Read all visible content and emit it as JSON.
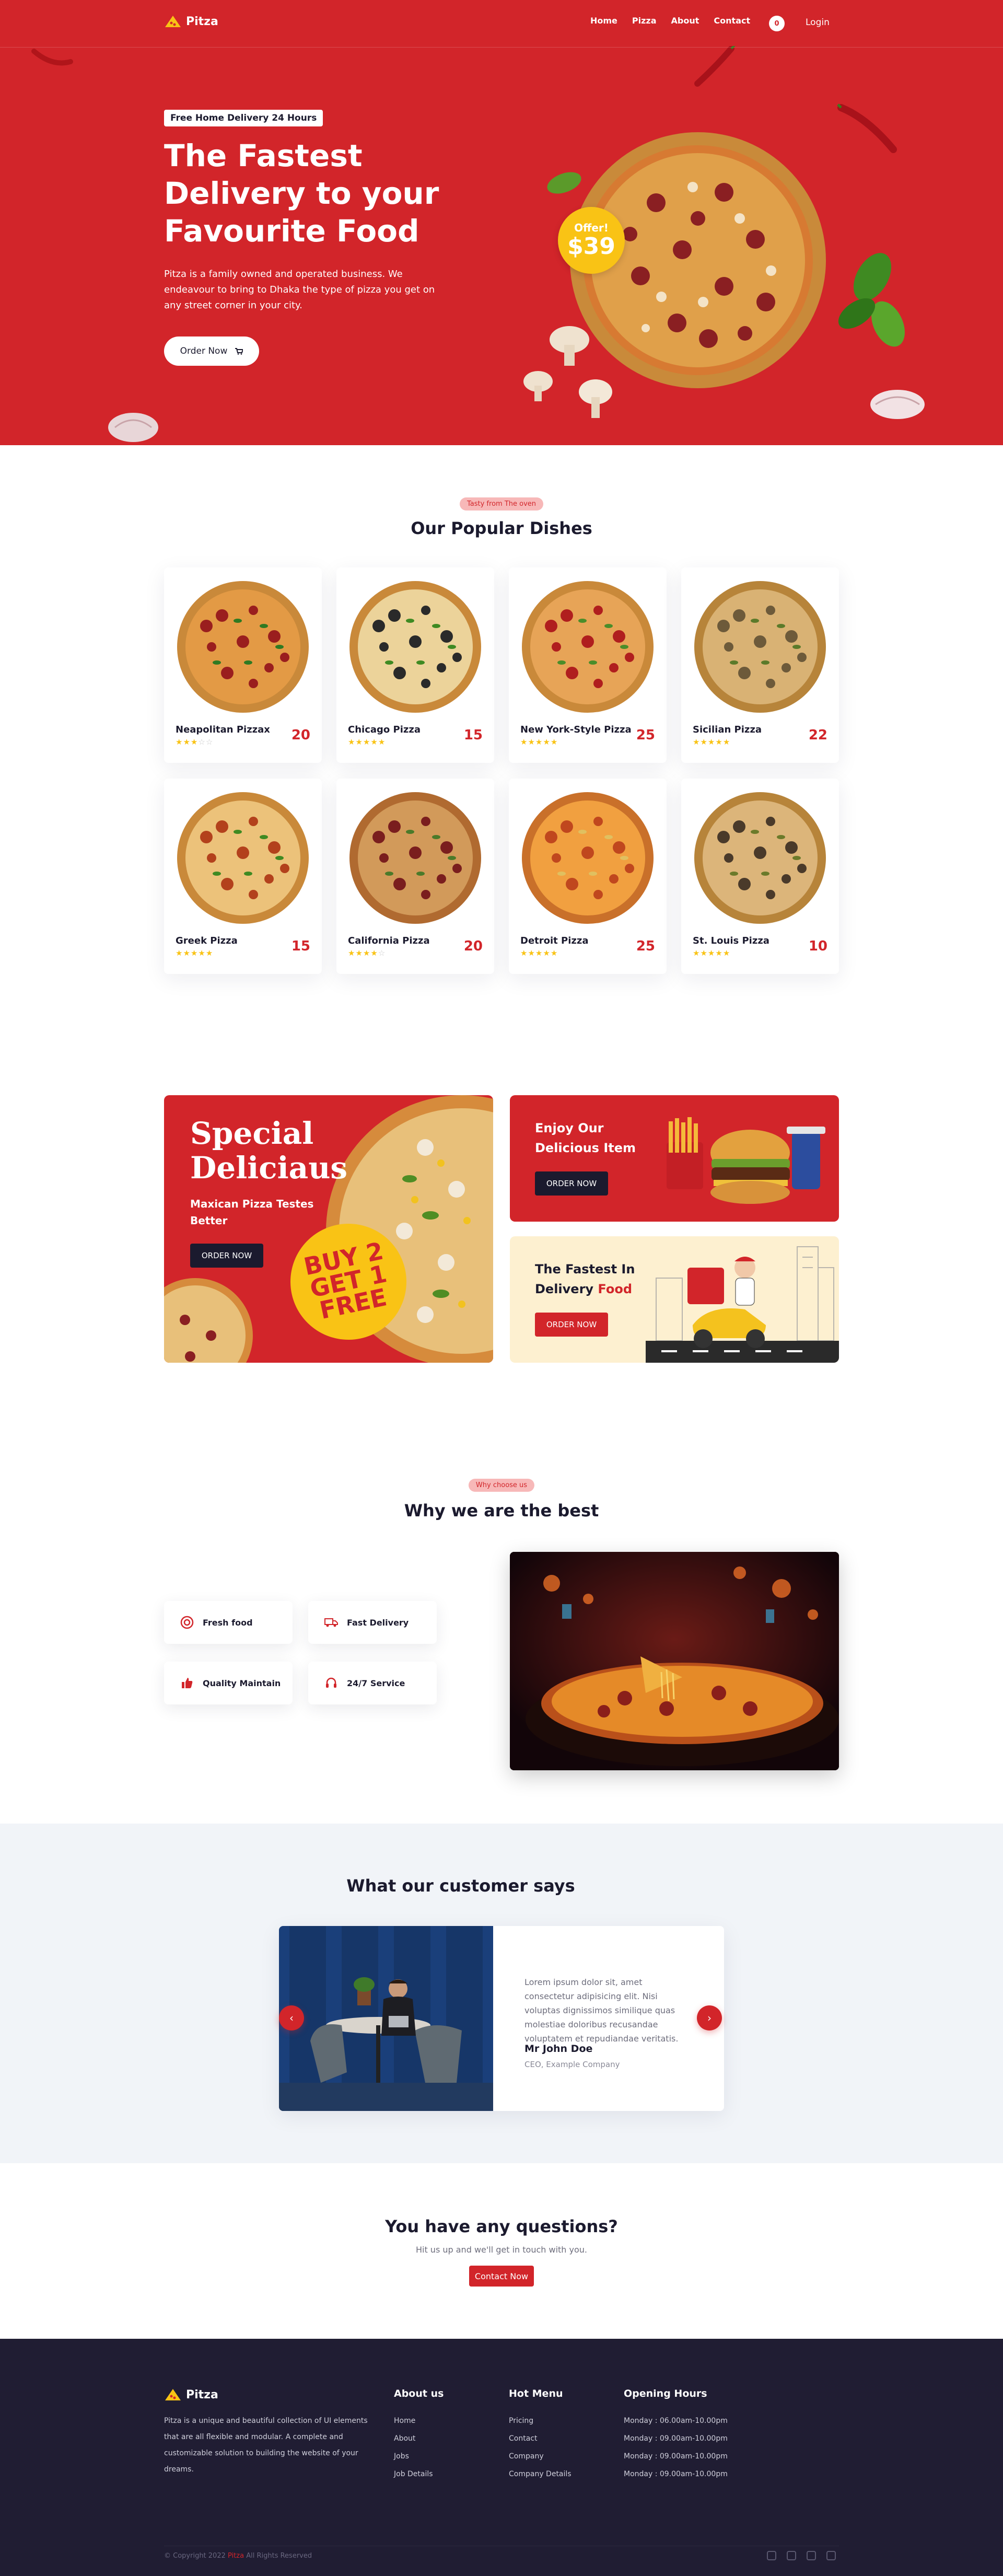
{
  "nav": {
    "brand": "Pitza",
    "links": [
      "Home",
      "Pizza",
      "About",
      "Contact"
    ],
    "cart_count": "0",
    "login": "Login"
  },
  "hero": {
    "badge": "Free Home Delivery 24 Hours",
    "title": "The Fastest Delivery to your Favourite Food",
    "description": "Pitza is a family owned and operated business. We endeavour to bring to Dhaka the type of pizza you get on any street corner in your city.",
    "cta": "Order Now",
    "offer_label": "Offer!",
    "offer_price": "$39"
  },
  "dishes": {
    "tag": "Tasty from The oven",
    "title": "Our Popular Dishes",
    "items": [
      {
        "name": "Neapolitan Pizzax",
        "price": "20",
        "rating": 3
      },
      {
        "name": "Chicago Pizza",
        "price": "15",
        "rating": 5
      },
      {
        "name": "New York-Style Pizza",
        "price": "25",
        "rating": 5
      },
      {
        "name": "Sicilian Pizza",
        "price": "22",
        "rating": 5
      },
      {
        "name": "Greek Pizza",
        "price": "15",
        "rating": 5
      },
      {
        "name": "California Pizza",
        "price": "20",
        "rating": 4
      },
      {
        "name": "Detroit Pizza",
        "price": "25",
        "rating": 5
      },
      {
        "name": "St. Louis Pizza",
        "price": "10",
        "rating": 5
      }
    ]
  },
  "promo": {
    "big_title": "Special Deliciaus",
    "big_subtitle": "Maxican Pizza Testes Better",
    "big_cta": "ORDER NOW",
    "buy_line1": "BUY 2",
    "buy_line2": "GET 1",
    "buy_line3": "FREE",
    "right1_title": "Enjoy Our Delicious Item",
    "right1_cta": "ORDER NOW",
    "right2_title_a": "The Fastest In Delivery ",
    "right2_title_b": "Food",
    "right2_cta": "ORDER NOW"
  },
  "why": {
    "tag": "Why choose us",
    "title": "Why we are the best",
    "features": [
      "Fresh food",
      "Fast Delivery",
      "Quality Maintain",
      "24/7 Service"
    ]
  },
  "testimonial": {
    "title": "What our customer says",
    "quote": "Lorem ipsum dolor sit, amet consectetur adipisicing elit. Nisi voluptas dignissimos similique quas molestiae doloribus recusandae voluptatem et repudiandae veritatis.",
    "name": "Mr John Doe",
    "role": "CEO, Example Company"
  },
  "questions": {
    "title": "You have any questions?",
    "subtitle": "Hit us up and we'll get in touch with you.",
    "cta": "Contact Now"
  },
  "footer": {
    "brand": "Pitza",
    "about": "Pitza is a unique and beautiful collection of UI elements that are all flexible and modular. A complete and customizable solution to building the website of your dreams.",
    "col1": {
      "title": "About us",
      "items": [
        "Home",
        "About",
        "Jobs",
        "Job Details"
      ]
    },
    "col2": {
      "title": "Hot Menu",
      "items": [
        "Pricing",
        "Contact",
        "Company",
        "Company Details"
      ]
    },
    "col3": {
      "title": "Opening Hours",
      "items": [
        "Monday : 06.00am-10.00pm",
        "Monday : 09.00am-10.00pm",
        "Monday : 09.00am-10.00pm",
        "Monday : 09.00am-10.00pm"
      ]
    },
    "copyright_a": "© Copyright 2022 ",
    "copyright_b": "Pitza",
    "copyright_c": " All Rights Reserved"
  },
  "colors": {
    "brand_red": "#d2252a",
    "accent_yellow": "#f9c315",
    "dark": "#1b1a2e"
  }
}
